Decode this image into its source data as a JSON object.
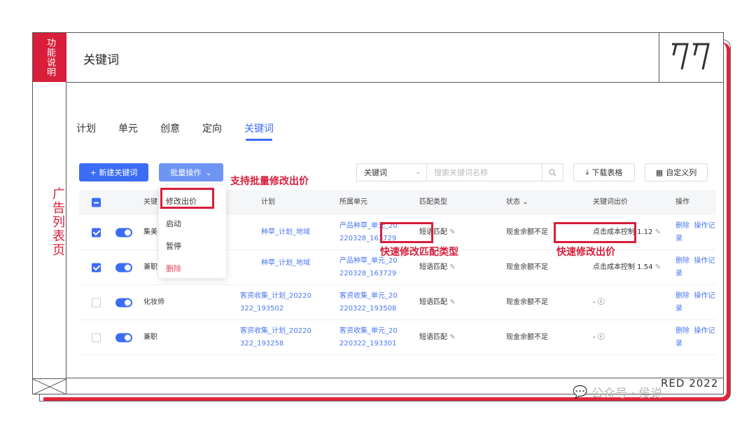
{
  "sidebar": {
    "top_label": "功能说明",
    "mid_label": "广告列表页"
  },
  "header": {
    "title": "关键词"
  },
  "tabs": [
    {
      "label": "计划"
    },
    {
      "label": "单元"
    },
    {
      "label": "创意"
    },
    {
      "label": "定向"
    },
    {
      "label": "关键词",
      "active": true
    }
  ],
  "toolbar": {
    "new_label": "+ 新建关键词",
    "batch_label": "批量操作",
    "batch_note": "支持批量修改出价",
    "search_select": "关键词",
    "search_placeholder": "搜索关键词名称",
    "download_label": "下载表格",
    "custom_label": "自定义列"
  },
  "dropdown": {
    "items": [
      {
        "label": "修改出价"
      },
      {
        "label": "启动"
      },
      {
        "label": "暂停"
      },
      {
        "label": "删除",
        "danger": true
      }
    ]
  },
  "table": {
    "headers": {
      "keyword": "关键",
      "plan": "计划",
      "unit": "所属单元",
      "match": "匹配类型",
      "status": "状态",
      "bid": "关键词出价",
      "ops": "操作"
    },
    "rows": [
      {
        "checked": true,
        "keyword": "集美",
        "plan_l1": "种草_计划_地域",
        "plan_l2": "",
        "unit_l1": "产品种草_单元_20",
        "unit_l2": "220328_163729",
        "match": "短语匹配",
        "status": "现金余额不足",
        "bid": "点击成本控制 1.12",
        "delete": "删除",
        "log": "操作记录"
      },
      {
        "checked": true,
        "keyword": "兼职",
        "plan_l1": "种草_计划_地域",
        "plan_l2": "",
        "unit_l1": "产品种草_单元_20",
        "unit_l2": "220328_163729",
        "match": "短语匹配",
        "status": "现金余额不足",
        "bid": "点击成本控制 1.54",
        "delete": "删除",
        "log": "操作记录"
      },
      {
        "checked": false,
        "keyword": "化妆师",
        "plan_l1": "客资收集_计划_20220",
        "plan_l2": "322_193502",
        "unit_l1": "客资收集_单元_20",
        "unit_l2": "220322_193508",
        "match": "短语匹配",
        "status": "现金余额不足",
        "bid": "- ⓘ",
        "delete": "删除",
        "log": "操作记录"
      },
      {
        "checked": false,
        "keyword": "兼职",
        "plan_l1": "客资收集_计划_20220",
        "plan_l2": "322_193258",
        "unit_l1": "客资收集_单元_20",
        "unit_l2": "220322_193301",
        "match": "短语匹配",
        "status": "现金余额不足",
        "bid": "- ⓘ",
        "delete": "删除",
        "log": "操作记录"
      }
    ]
  },
  "annotations": {
    "match_note": "快速修改匹配类型",
    "bid_note": "快速修改出价"
  },
  "footer": {
    "watermark": "公众号 · 侯说",
    "brand": "RED 2022"
  },
  "colors": {
    "accent": "#3b6cf6",
    "red": "#d81e3b"
  }
}
